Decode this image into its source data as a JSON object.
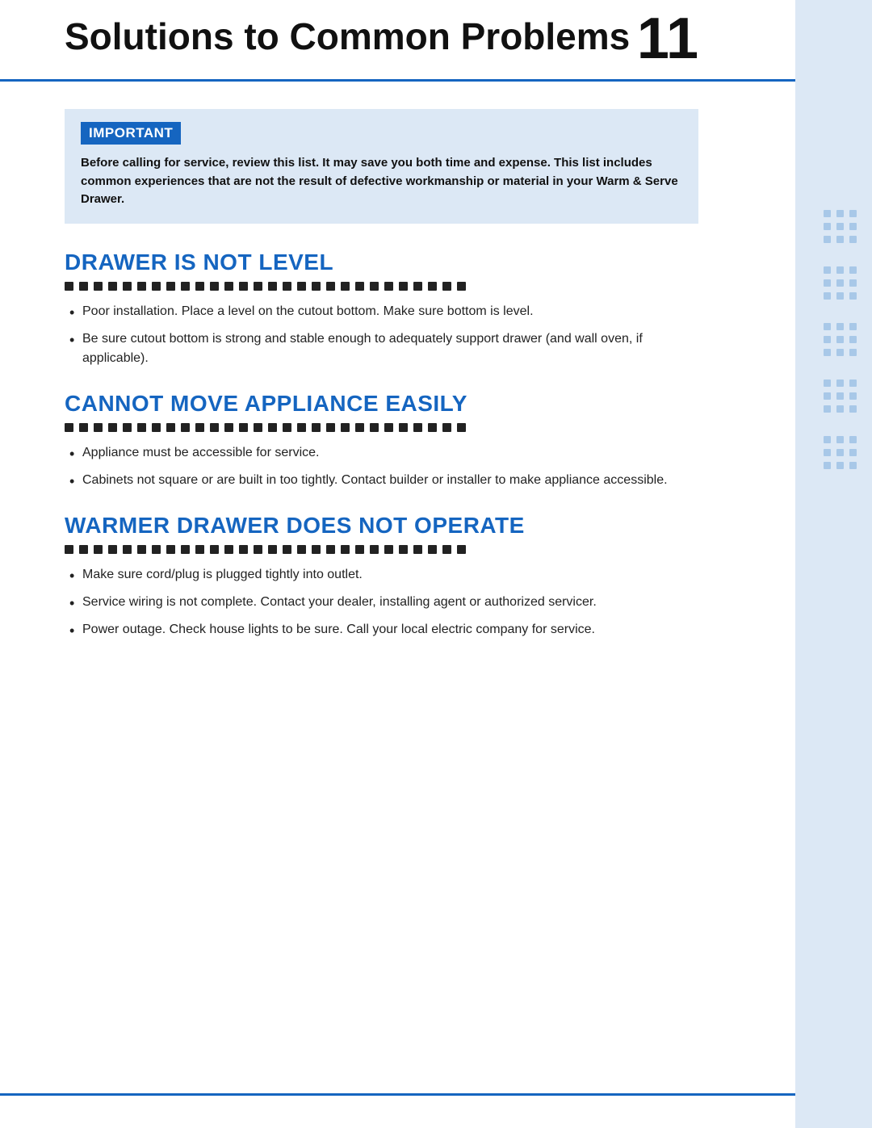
{
  "header": {
    "title": "Solutions to Common Problems",
    "page_number": "11"
  },
  "important": {
    "label": "IMPORTANT",
    "text": "Before calling for service, review this list. It may save you both time and expense. This list includes common experiences that are not the result of defective workmanship or material in your Warm & Serve Drawer."
  },
  "sections": [
    {
      "id": "drawer-not-level",
      "heading": "DRAWER IS NOT LEVEL",
      "bullets": [
        "Poor installation. Place a level on the cutout bottom. Make sure bottom is level.",
        "Be sure cutout bottom is strong and stable enough to adequately support drawer (and wall oven, if applicable)."
      ]
    },
    {
      "id": "cannot-move-appliance",
      "heading": "CANNOT MOVE APPLIANCE EASILY",
      "bullets": [
        "Appliance must be accessible for service.",
        "Cabinets not square or are built in too tightly. Contact builder or installer to make appliance accessible."
      ]
    },
    {
      "id": "warmer-drawer-not-operate",
      "heading": "WARMER DRAWER DOES NOT OPERATE",
      "bullets": [
        "Make sure cord/plug is plugged tightly into outlet.",
        "Service wiring is not complete. Contact your dealer, installing agent or authorized servicer.",
        "Power outage. Check house lights to be sure. Call your local electric company for service."
      ]
    }
  ]
}
